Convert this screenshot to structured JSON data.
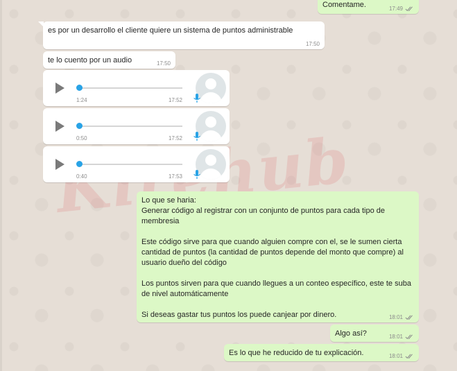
{
  "colors": {
    "chat_background": "#e6ded6",
    "incoming_bubble": "#ffffff",
    "outgoing_bubble": "#dcf8c6",
    "read_ticks": "#8c8c8c",
    "audio_progress": "#29a3e6"
  },
  "messages": {
    "top_out": {
      "text": "Comentame.",
      "time": "17:49"
    },
    "in1": {
      "text": "es por un desarrollo el cliente quiere un sistema de puntos administrable",
      "time": "17:50"
    },
    "in2": {
      "text": "te lo cuento por un audio",
      "time": "17:50"
    },
    "long_out": {
      "text": "Lo que se haria:\nGenerar código al registrar con un conjunto de puntos para cada tipo de membresia\n\nEste código sirve para que cuando alguien compre con el, se le sumen cierta cantidad de puntos (la cantidad de puntos depende del monto que compre) al usuario dueño del código\n\nLos puntos sirven para que cuando llegues a un conteo específico, este te suba de nivel automáticamente\n\nSi deseas gastar tus puntos los puede canjear por dinero.",
      "time": "18:01"
    },
    "out2": {
      "text": "Algo así?",
      "time": "18:01"
    },
    "out3": {
      "text": "Es lo que he reducido de tu explicación.",
      "time": "18:01"
    }
  },
  "audios": [
    {
      "duration": "1:24",
      "time": "17:52",
      "progress": 0
    },
    {
      "duration": "0:50",
      "time": "17:52",
      "progress": 0
    },
    {
      "duration": "0:40",
      "time": "17:53",
      "progress": 0
    }
  ],
  "icons": {
    "play": "play-icon",
    "mic": "microphone-icon",
    "avatar": "default-avatar-icon",
    "ticks": "double-check-icon"
  },
  "watermark": {
    "text": "Kirehub"
  }
}
